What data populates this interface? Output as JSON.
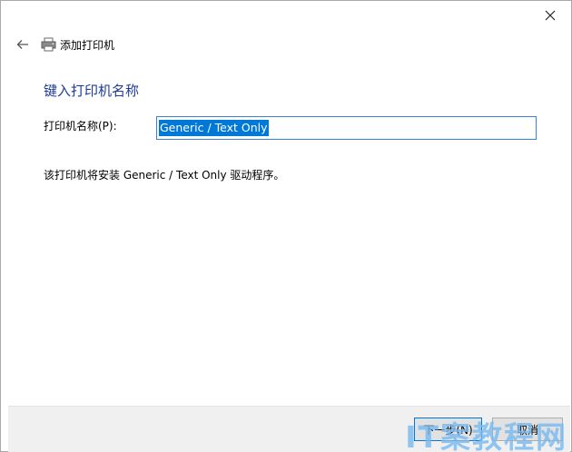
{
  "window": {
    "title": "添加打印机"
  },
  "icons": {
    "back": "back-arrow-icon",
    "printer": "printer-icon",
    "close": "close-icon"
  },
  "page": {
    "heading": "键入打印机名称",
    "name_label": "打印机名称(P):",
    "name_value": "Generic / Text Only",
    "driver_note": "该打印机将安装 Generic / Text Only 驱动程序。"
  },
  "footer": {
    "next_label": "下一步(N)",
    "cancel_label": "取消"
  },
  "watermark": {
    "text": "IT案教程网"
  },
  "colors": {
    "heading": "#1e3c96",
    "selection": "#0078d7",
    "input_border": "#3c82d2",
    "footer_bg": "#f0f0f0"
  }
}
